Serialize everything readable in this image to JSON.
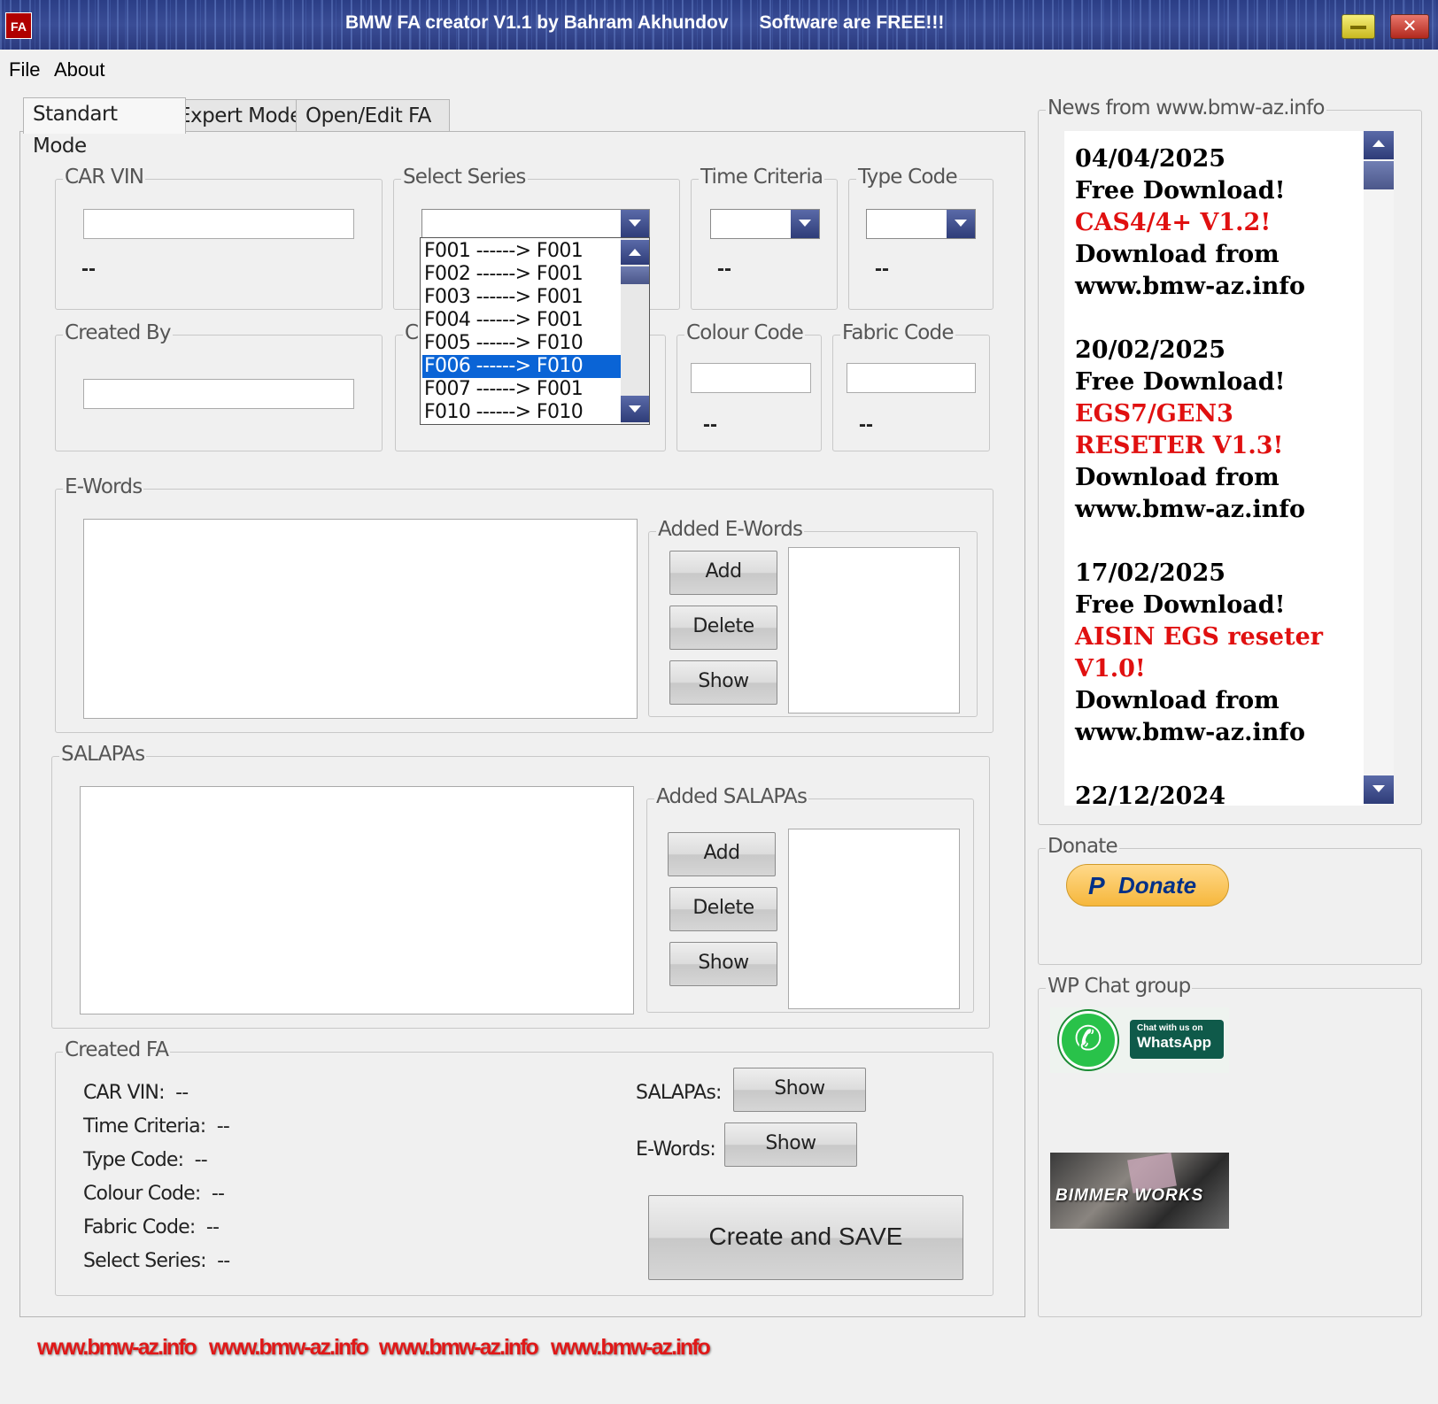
{
  "window": {
    "title": "BMW FA creator V1.1 by Bahram Akhundov      Software are FREE!!!",
    "icon_text": "FA"
  },
  "menu": [
    "File",
    "About"
  ],
  "tabs": [
    "Standart Mode",
    "Expert Mode",
    "Open/Edit FA"
  ],
  "groups": {
    "car_vin": "CAR VIN",
    "select_series": "Select Series",
    "time_criteria": "Time Criteria",
    "type_code": "Type Code",
    "created_by": "Created By",
    "partial_hidden": "C",
    "colour_code": "Colour Code",
    "fabric_code": "Fabric Code",
    "e_words": "E-Words",
    "added_e_words": "Added E-Words",
    "salapas": "SALAPAs",
    "added_salapas": "Added SALAPAs",
    "created_fa": "Created FA",
    "news": "News from www.bmw-az.info",
    "donate": "Donate",
    "wp_chat": "WP Chat group"
  },
  "placeholder_value": "--",
  "series_options": [
    "F001 ------> F001",
    "F002 ------> F001",
    "F003 ------> F001",
    "F004 ------> F001",
    "F005 ------> F010",
    "F006 ------> F010",
    "F007 ------> F001",
    "F010 ------> F010"
  ],
  "series_selected_index": 5,
  "buttons": {
    "add": "Add",
    "delete": "Delete",
    "show": "Show",
    "create_save": "Create and SAVE",
    "donate": "Donate"
  },
  "created_fa": {
    "rows": [
      "CAR VIN:  --",
      "Time Criteria:  --",
      "Type Code:  --",
      "Colour Code:  --",
      "Fabric Code:  --",
      "Select Series:  --"
    ],
    "salapas_label": "SALAPAs:",
    "e_words_label": "E-Words:"
  },
  "news": [
    {
      "date": "04/04/2025",
      "lines": [
        {
          "t": "Free Download!",
          "red": false
        },
        {
          "t": "CAS4/4+ V1.2!",
          "red": true
        },
        {
          "t": "Download from",
          "red": false
        },
        {
          "t": "www.bmw-az.info",
          "red": false
        }
      ]
    },
    {
      "date": "20/02/2025",
      "lines": [
        {
          "t": "Free Download!",
          "red": false
        },
        {
          "t": "EGS7/GEN3",
          "red": true
        },
        {
          "t": "RESETER V1.3!",
          "red": true
        },
        {
          "t": "Download from",
          "red": false
        },
        {
          "t": "www.bmw-az.info",
          "red": false
        }
      ]
    },
    {
      "date": "17/02/2025",
      "lines": [
        {
          "t": "Free Download!",
          "red": false
        },
        {
          "t": "AISIN EGS reseter",
          "red": true
        },
        {
          "t": "V1.0!",
          "red": true
        },
        {
          "t": "Download from",
          "red": false
        },
        {
          "t": "www.bmw-az.info",
          "red": false
        }
      ]
    },
    {
      "date": "22/12/2024",
      "lines": []
    }
  ],
  "whatsapp_badge": {
    "line1": "Chat with us on",
    "line2": "WhatsApp"
  },
  "bimmerworks_text": "BIMMER WORKS",
  "footer_links": [
    "www.bmw-az.info",
    "www.bmw-az.info",
    "www.bmw-az.info",
    "www.bmw-az.info"
  ],
  "colors": {
    "accent_red": "#e01818",
    "selection_blue": "#0a64d6",
    "titlebar": "#2b3e86",
    "paypal_blue": "#003087"
  }
}
